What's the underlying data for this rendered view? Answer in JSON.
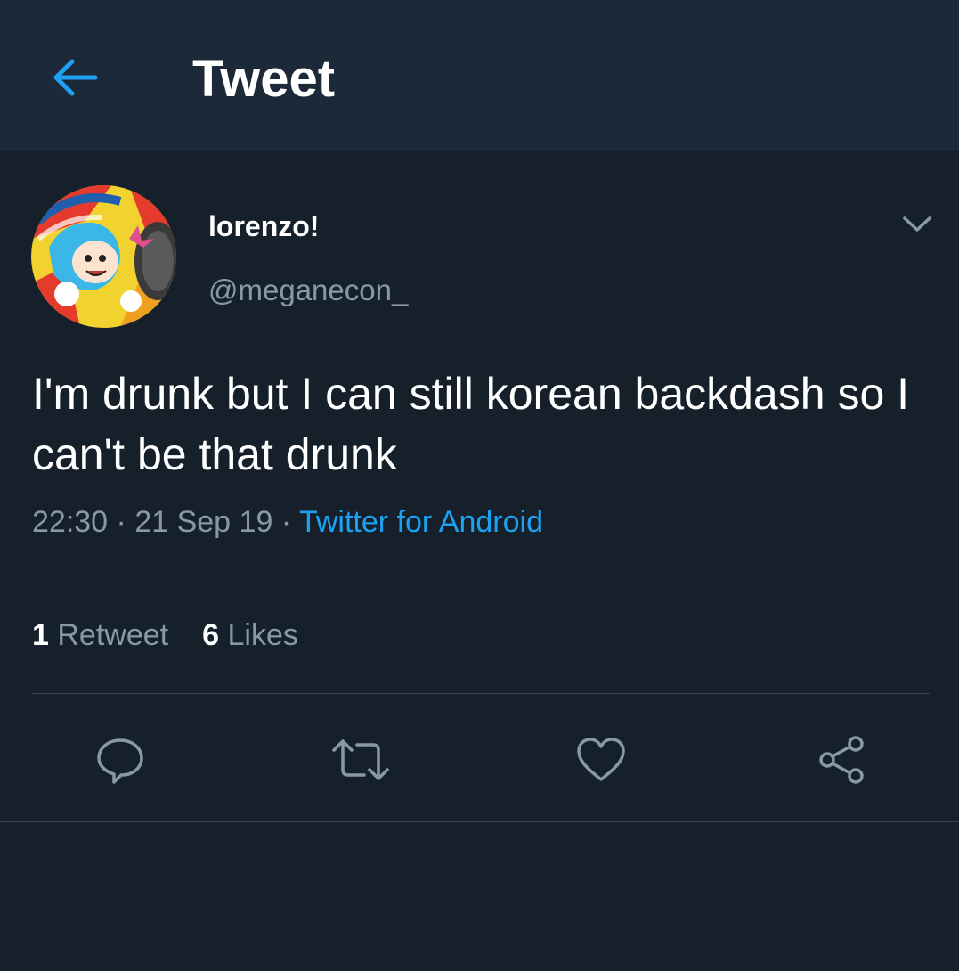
{
  "header": {
    "title": "Tweet",
    "back_icon": "arrow-left-icon",
    "accent_color": "#1da1f2"
  },
  "tweet": {
    "author": {
      "display_name": "lorenzo!",
      "handle": "@meganecon_"
    },
    "text": "I'm drunk but I can still korean backdash so I can't be that drunk",
    "time": "22:30",
    "date": "21 Sep 19",
    "separator": "·",
    "source": "Twitter for Android",
    "stats": {
      "retweets_count": "1",
      "retweets_label": "Retweet",
      "likes_count": "6",
      "likes_label": "Likes"
    },
    "actions": [
      "reply-icon",
      "retweet-icon",
      "like-icon",
      "share-icon"
    ]
  },
  "colors": {
    "background": "#15202b",
    "header_bg": "#1c2938",
    "secondary_text": "#8899a6",
    "divider": "#38444d"
  }
}
